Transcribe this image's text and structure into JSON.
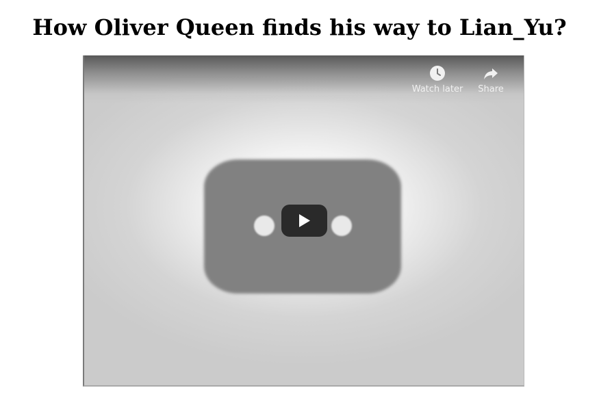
{
  "page": {
    "title": "How Oliver Queen finds his way to Lian_Yu?"
  },
  "video": {
    "overlay": {
      "watch_later": {
        "label": "Watch later",
        "icon": "clock-icon"
      },
      "share": {
        "label": "Share",
        "icon": "share-arrow-icon"
      }
    },
    "play_button": {
      "icon": "play-icon"
    },
    "colors": {
      "play_button_bg": "#2a2a2a",
      "overlay_text": "#f1f1f1"
    }
  }
}
